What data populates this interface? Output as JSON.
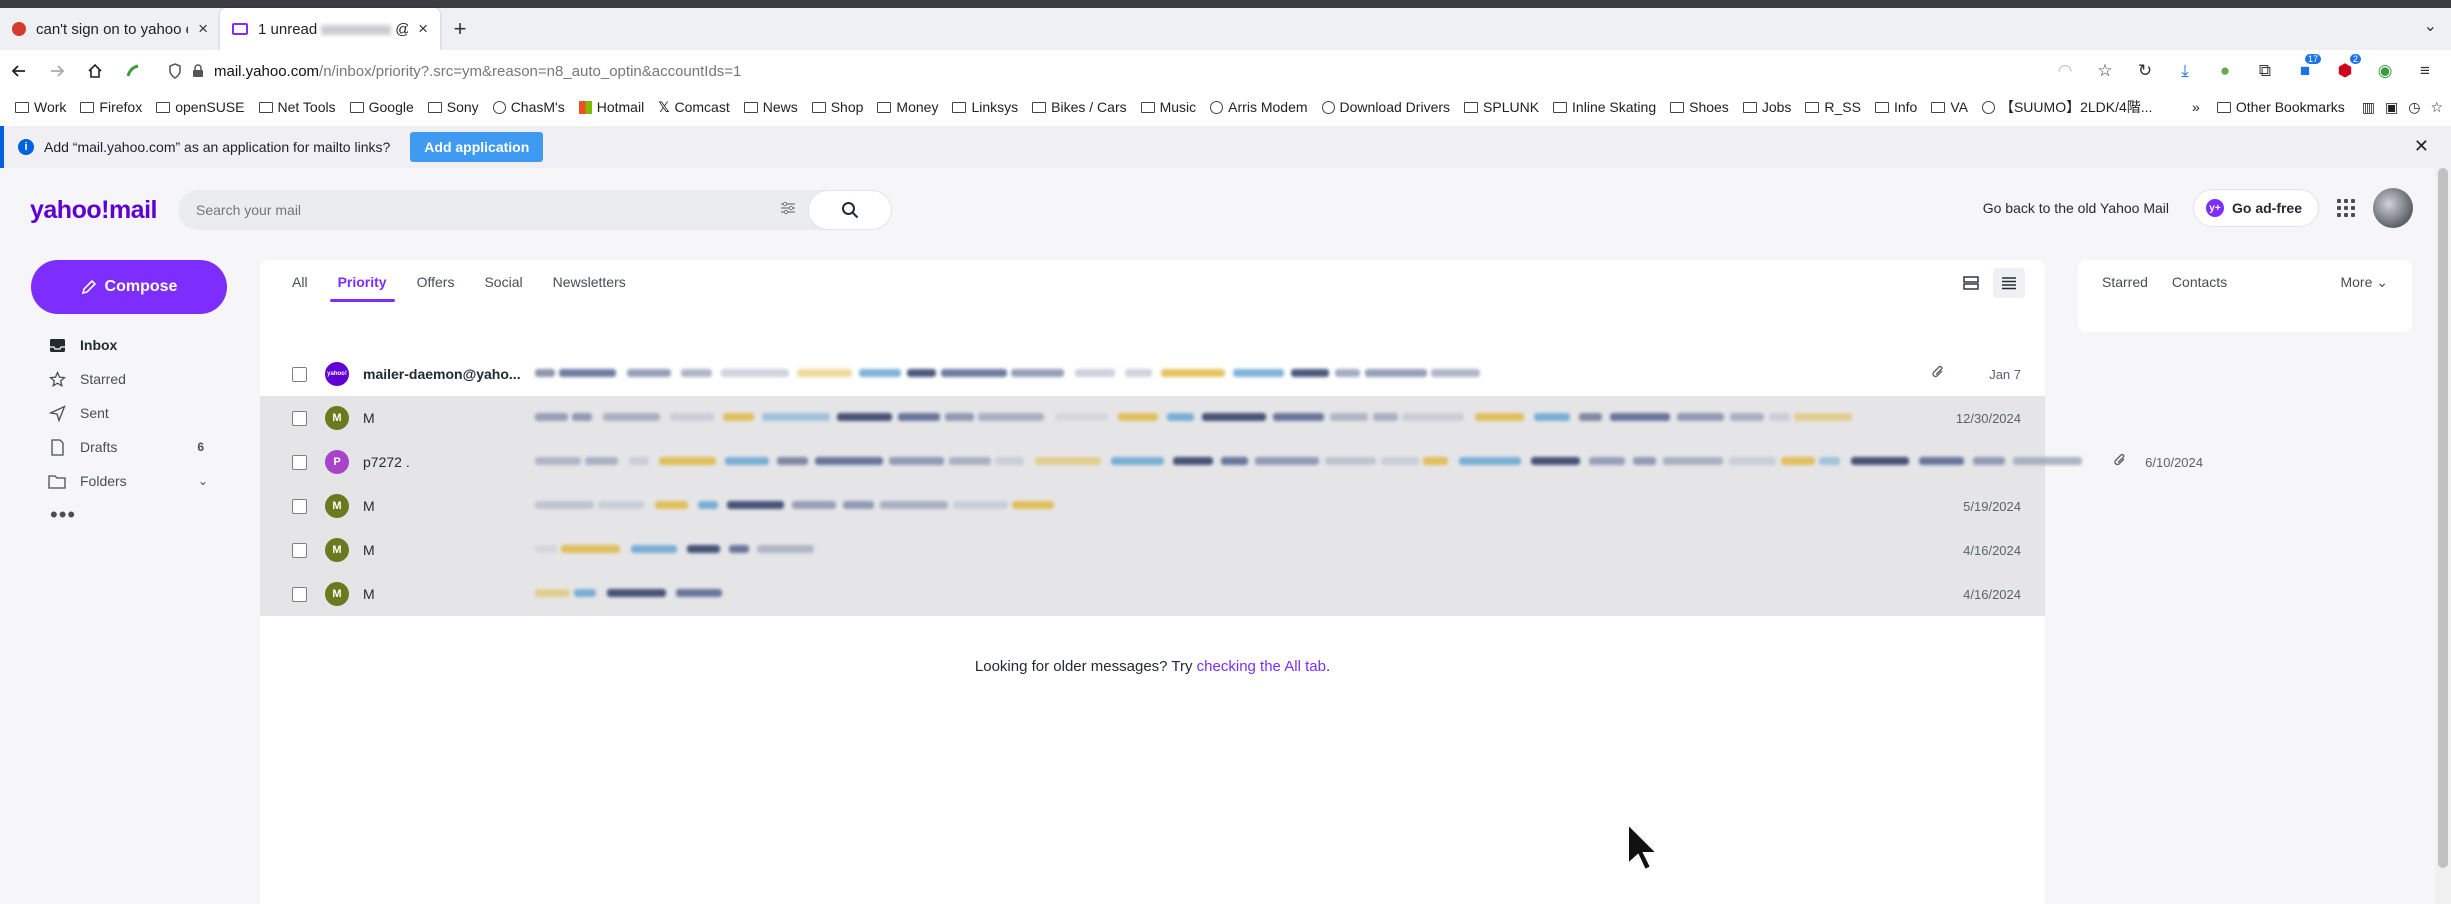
{
  "browser": {
    "tabs": [
      {
        "title": "can't sign on to yahoo ema",
        "active": false
      },
      {
        "title": "1 unread",
        "title_suffix": "@yahoo",
        "active": true
      }
    ],
    "url": {
      "host": "mail.yahoo.com",
      "path": "/n/inbox/priority?.src=ym&reason=n8_auto_optin&accountIds=1"
    },
    "extension_badges": {
      "ext1": "17",
      "ext2": "2"
    },
    "bookmarks": [
      {
        "label": "Work",
        "icon": "folder"
      },
      {
        "label": "Firefox",
        "icon": "folder"
      },
      {
        "label": "openSUSE",
        "icon": "folder"
      },
      {
        "label": "Net Tools",
        "icon": "folder"
      },
      {
        "label": "Google",
        "icon": "folder"
      },
      {
        "label": "Sony",
        "icon": "folder"
      },
      {
        "label": "ChasM's",
        "icon": "globe"
      },
      {
        "label": "Hotmail",
        "icon": "windows"
      },
      {
        "label": "Comcast",
        "icon": "x"
      },
      {
        "label": "News",
        "icon": "folder"
      },
      {
        "label": "Shop",
        "icon": "folder"
      },
      {
        "label": "Money",
        "icon": "folder"
      },
      {
        "label": "Linksys",
        "icon": "folder"
      },
      {
        "label": "Bikes / Cars",
        "icon": "folder"
      },
      {
        "label": "Music",
        "icon": "folder"
      },
      {
        "label": "Arris Modem",
        "icon": "globe"
      },
      {
        "label": "Download Drivers",
        "icon": "globe"
      },
      {
        "label": "SPLUNK",
        "icon": "folder"
      },
      {
        "label": "Inline Skating",
        "icon": "folder"
      },
      {
        "label": "Shoes",
        "icon": "folder"
      },
      {
        "label": "Jobs",
        "icon": "folder"
      },
      {
        "label": "R_SS",
        "icon": "folder"
      },
      {
        "label": "Info",
        "icon": "folder"
      },
      {
        "label": "VA",
        "icon": "folder"
      },
      {
        "label": "【SUUMO】2LDK/4階...",
        "icon": "globe"
      }
    ],
    "other_bookmarks": "Other Bookmarks",
    "infobar": {
      "message": "Add “mail.yahoo.com” as an application for mailto links?",
      "button": "Add application"
    }
  },
  "mail": {
    "logo": "yahoo!mail",
    "search_placeholder": "Search your mail",
    "go_back_label": "Go back to the old Yahoo Mail",
    "ad_free_label": "Go ad-free",
    "compose_label": "Compose",
    "nav": [
      {
        "label": "Inbox",
        "icon": "inbox-icon",
        "count": ""
      },
      {
        "label": "Starred",
        "icon": "star-icon",
        "count": ""
      },
      {
        "label": "Sent",
        "icon": "send-icon",
        "count": ""
      },
      {
        "label": "Drafts",
        "icon": "drafts-icon",
        "count": "6"
      },
      {
        "label": "Folders",
        "icon": "folder-icon",
        "count": ""
      }
    ],
    "more_dots": "•••",
    "filter_tabs": [
      "All",
      "Priority",
      "Offers",
      "Social",
      "Newsletters"
    ],
    "active_tab": "Priority",
    "messages": [
      {
        "sender": "mailer-daemon@yaho...",
        "avatar": "yahoo!",
        "avatar_color": "#6001d2",
        "unread": true,
        "attachment": true,
        "date": "Jan 7"
      },
      {
        "sender": "M",
        "avatar": "M",
        "avatar_color": "#6b7a1f",
        "unread": false,
        "attachment": false,
        "date": "12/30/2024"
      },
      {
        "sender": "p7272 .",
        "avatar": "P",
        "avatar_color": "#a744c7",
        "unread": false,
        "attachment": true,
        "date": "6/10/2024"
      },
      {
        "sender": "M",
        "avatar": "M",
        "avatar_color": "#6b7a1f",
        "unread": false,
        "attachment": false,
        "date": "5/19/2024"
      },
      {
        "sender": "M",
        "avatar": "M",
        "avatar_color": "#6b7a1f",
        "unread": false,
        "attachment": false,
        "date": "4/16/2024"
      },
      {
        "sender": "M",
        "avatar": "M",
        "avatar_color": "#6b7a1f",
        "unread": false,
        "attachment": false,
        "date": "4/16/2024"
      }
    ],
    "older_prefix": "Looking for older messages? Try ",
    "older_link": "checking the All tab",
    "older_suffix": ".",
    "right_tabs": [
      "Starred",
      "Contacts"
    ],
    "right_more": "More"
  },
  "colors": {
    "accent": "#7d2eff",
    "brand": "#5f01d1"
  }
}
